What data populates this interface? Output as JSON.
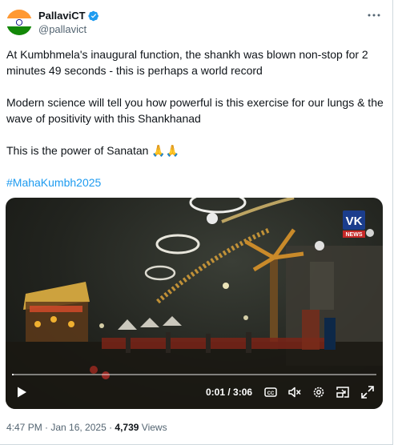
{
  "author": {
    "display_name": "PallaviCT",
    "handle": "@pallavict"
  },
  "tweet": {
    "paragraphs": [
      "At Kumbhmela's inaugural function, the shankh was blown non-stop for 2 minutes 49 seconds - this is perhaps a world record",
      "Modern science will tell you how powerful is this exercise for our lungs & the wave of positivity with this Shankhanad",
      "This is the power of Sanatan 🙏🙏"
    ],
    "hashtag": "#MahaKumbh2025"
  },
  "video": {
    "watermark": "VK",
    "watermark_sub": "NEWS",
    "time_display": "0:01 / 3:06",
    "progress": 0.005
  },
  "meta": {
    "timestamp": "4:47 PM · Jan 16, 2025 · ",
    "views_count": "4,739",
    "views_label": " Views"
  },
  "colors": {
    "accent": "#1d9bf0",
    "text": "#0f1419",
    "muted": "#536471"
  },
  "icons": [
    "verified-badge-icon",
    "more-icon",
    "play-icon",
    "captions-icon",
    "mute-icon",
    "settings-icon",
    "pip-icon",
    "fullscreen-icon"
  ]
}
